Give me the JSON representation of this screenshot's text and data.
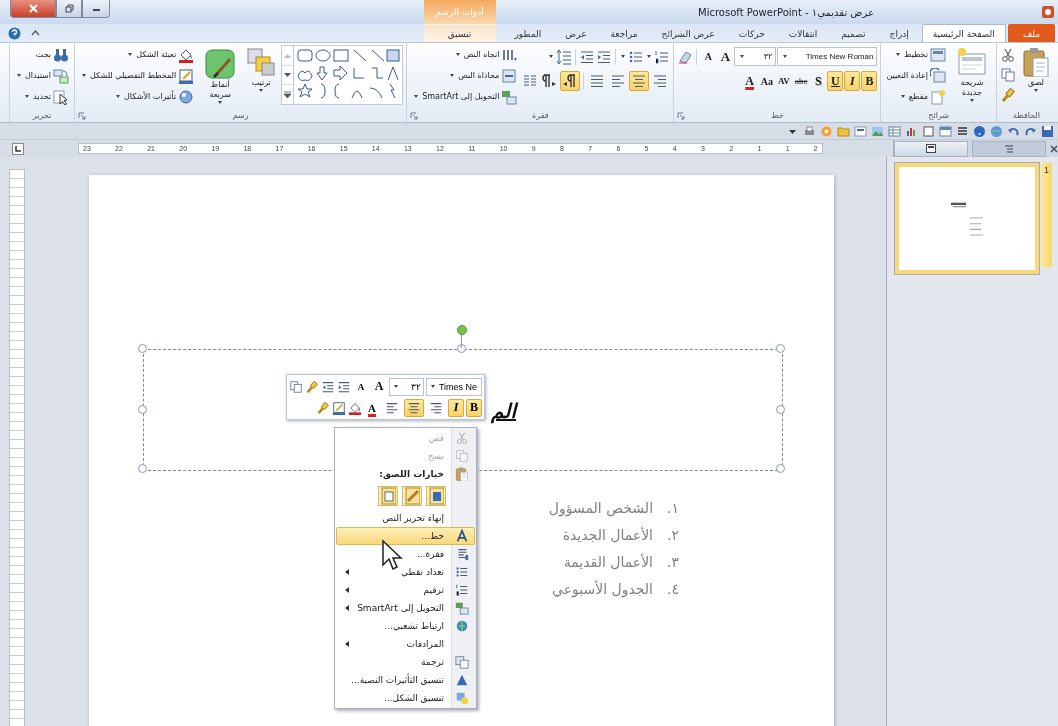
{
  "window": {
    "title": "Microsoft PowerPoint - عرض تقديمي١",
    "context_group": "أدوات الرسم"
  },
  "tabs": [
    {
      "label": "ملف",
      "kind": "file",
      "selected": false
    },
    {
      "label": "الصفحة الرئيسية",
      "kind": "normal",
      "selected": true
    },
    {
      "label": "إدراج",
      "kind": "normal",
      "selected": false
    },
    {
      "label": "تصميم",
      "kind": "normal",
      "selected": false
    },
    {
      "label": "انتقالات",
      "kind": "normal",
      "selected": false
    },
    {
      "label": "حركات",
      "kind": "normal",
      "selected": false
    },
    {
      "label": "عرض الشرائح",
      "kind": "normal",
      "selected": false
    },
    {
      "label": "مراجعة",
      "kind": "normal",
      "selected": false
    },
    {
      "label": "عرض",
      "kind": "normal",
      "selected": false
    },
    {
      "label": "المطور",
      "kind": "normal",
      "selected": false
    },
    {
      "label": "تنسيق",
      "kind": "contextual",
      "selected": false
    }
  ],
  "ribbon": [
    {
      "kind": "clipboard",
      "title": "الحافظة",
      "paste": "لصق"
    },
    {
      "kind": "slides",
      "title": "شرائح",
      "new_slide": "شريحة جديدة",
      "commands": [
        "تخطيط",
        "إعادة التعيين",
        "مقطع"
      ]
    },
    {
      "kind": "font",
      "title": "خط",
      "font_name": "Times New Roman",
      "font_size": "٣٢",
      "sizers": [
        "A",
        "A"
      ],
      "buttons": [
        {
          "glyph": "B",
          "pressed": true
        },
        {
          "glyph": "I",
          "pressed": true
        },
        {
          "glyph": "U",
          "pressed": true
        },
        {
          "glyph": "S",
          "pressed": false
        },
        {
          "glyph": "abc",
          "pressed": false
        },
        {
          "glyph": "AV",
          "pressed": false
        },
        {
          "glyph": "Aa",
          "pressed": false
        },
        {
          "glyph": "A",
          "pressed": false
        }
      ]
    },
    {
      "kind": "paragraph",
      "title": "فقرة",
      "commands": [
        "اتجاه النص",
        "محاذاة النص",
        "التحويل إلى SmartArt"
      ],
      "align": [
        {
          "pressed": false
        },
        {
          "pressed": true
        },
        {
          "pressed": false
        },
        {
          "pressed": false
        }
      ],
      "direction": [
        {
          "pressed": true
        },
        {
          "pressed": false
        }
      ]
    },
    {
      "kind": "drawing",
      "title": "رسم",
      "arrange": "ترتيب",
      "quick_styles": "أنماط سريعة",
      "commands": [
        "تعبئة الشكل",
        "المخطط التفصيلي للشكل",
        "تأثيرات الأشكال"
      ]
    },
    {
      "kind": "editing",
      "title": "تحرير",
      "commands": [
        "بحث",
        "استبدال",
        "تحديد"
      ]
    }
  ],
  "ruler": {
    "labels": [
      "2",
      "1",
      "1",
      "2",
      "3",
      "4",
      "5",
      "6",
      "7",
      "8",
      "9",
      "10",
      "11",
      "12",
      "13",
      "14",
      "15",
      "16",
      "17",
      "18",
      "19",
      "20",
      "21",
      "22",
      "23"
    ]
  },
  "slide": {
    "title": "الم",
    "items": [
      {
        "number": "١.",
        "text": "الشخص المسؤول"
      },
      {
        "number": "٢.",
        "text": "الأعمال الجديدة"
      },
      {
        "number": "٣.",
        "text": "الأعمال القديمة"
      },
      {
        "number": "٤.",
        "text": "الجدول الأسبوعي"
      }
    ]
  },
  "thumbnails": [
    {
      "number": "1",
      "selected": true
    }
  ],
  "mini_toolbar": {
    "font_name": "Times Ne",
    "font_size": "٣٢",
    "sizers": [
      "A",
      "A"
    ],
    "font_color": "A",
    "buttons": [
      {
        "glyph": "B",
        "pressed": true
      },
      {
        "glyph": "I",
        "pressed": true
      }
    ],
    "align": [
      {
        "pressed": false
      },
      {
        "pressed": true
      },
      {
        "pressed": false
      }
    ]
  },
  "context_menu": [
    {
      "kind": "item",
      "label": "قص",
      "disabled": true,
      "selected": false,
      "submenu": false
    },
    {
      "kind": "item",
      "label": "نسخ",
      "disabled": true,
      "selected": false,
      "submenu": false
    },
    {
      "kind": "header",
      "label": "خيارات اللصق:",
      "disabled": false,
      "selected": false,
      "submenu": false
    },
    {
      "kind": "paste",
      "disabled": false,
      "selected": false,
      "submenu": false
    },
    {
      "kind": "item",
      "label": "إنهاء تحرير النص",
      "disabled": false,
      "selected": false,
      "submenu": false
    },
    {
      "kind": "item",
      "label": "خط...",
      "disabled": false,
      "selected": true,
      "submenu": false
    },
    {
      "kind": "item",
      "label": "فقرة...",
      "disabled": false,
      "selected": false,
      "submenu": false
    },
    {
      "kind": "item",
      "label": "تعداد نقطي",
      "disabled": false,
      "selected": false,
      "submenu": true
    },
    {
      "kind": "item",
      "label": "ترقيم",
      "disabled": false,
      "selected": false,
      "submenu": true
    },
    {
      "kind": "item",
      "label": "التحويل إلى SmartArt",
      "disabled": false,
      "selected": false,
      "submenu": true
    },
    {
      "kind": "item",
      "label": "ارتباط تشعبي...",
      "disabled": false,
      "selected": false,
      "submenu": false
    },
    {
      "kind": "item",
      "label": "المرادفات",
      "disabled": false,
      "selected": false,
      "submenu": true
    },
    {
      "kind": "item",
      "label": "ترجمة",
      "disabled": false,
      "selected": false,
      "submenu": false
    },
    {
      "kind": "item",
      "label": "تنسيق التأثيرات النصية...",
      "disabled": false,
      "selected": false,
      "submenu": false
    },
    {
      "kind": "item",
      "label": "تنسيق الشكل...",
      "disabled": false,
      "selected": false,
      "submenu": false
    }
  ]
}
